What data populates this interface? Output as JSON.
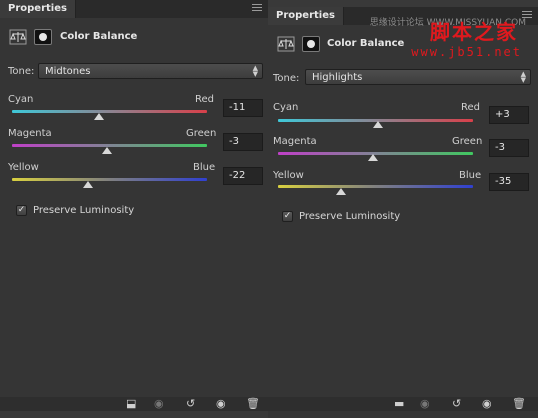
{
  "left_panel": {
    "tab": "Properties",
    "title": "Color Balance",
    "tone_label": "Tone:",
    "tone_value": "Midtones",
    "sliders": [
      {
        "left": "Cyan",
        "right": "Red",
        "value": "-11",
        "level": -11
      },
      {
        "left": "Magenta",
        "right": "Green",
        "value": "-3",
        "level": -3
      },
      {
        "left": "Yellow",
        "right": "Blue",
        "value": "-22",
        "level": -22
      }
    ],
    "preserve_label": "Preserve Luminosity",
    "preserve_checked": "✓"
  },
  "right_panel": {
    "tab": "Properties",
    "title": "Color Balance",
    "tone_label": "Tone:",
    "tone_value": "Highlights",
    "sliders": [
      {
        "left": "Cyan",
        "right": "Red",
        "value": "+3",
        "level": 3
      },
      {
        "left": "Magenta",
        "right": "Green",
        "value": "-3",
        "level": -3
      },
      {
        "left": "Yellow",
        "right": "Blue",
        "value": "-35",
        "level": -35
      }
    ],
    "preserve_label": "Preserve Luminosity",
    "preserve_checked": "✓"
  },
  "watermark": {
    "top_text": "思缘设计论坛 WWW.MISSYUAN.COM",
    "brand": "脚本之家",
    "url": "www.jb51.net"
  },
  "colors": {
    "cyan_red": [
      "#3fc8d8",
      "#d8404a"
    ],
    "magenta_green": [
      "#c040c8",
      "#40c860"
    ],
    "yellow_blue": [
      "#d8d040",
      "#3040d0"
    ],
    "brand_red": "#e0191e"
  },
  "icons": {
    "balance": "scale-icon",
    "mask": "mask-icon",
    "panel_menu": "menu-icon",
    "footer": [
      "clip-icon",
      "visibility-toggle-icon",
      "reset-icon",
      "eye-icon",
      "trash-icon"
    ]
  }
}
